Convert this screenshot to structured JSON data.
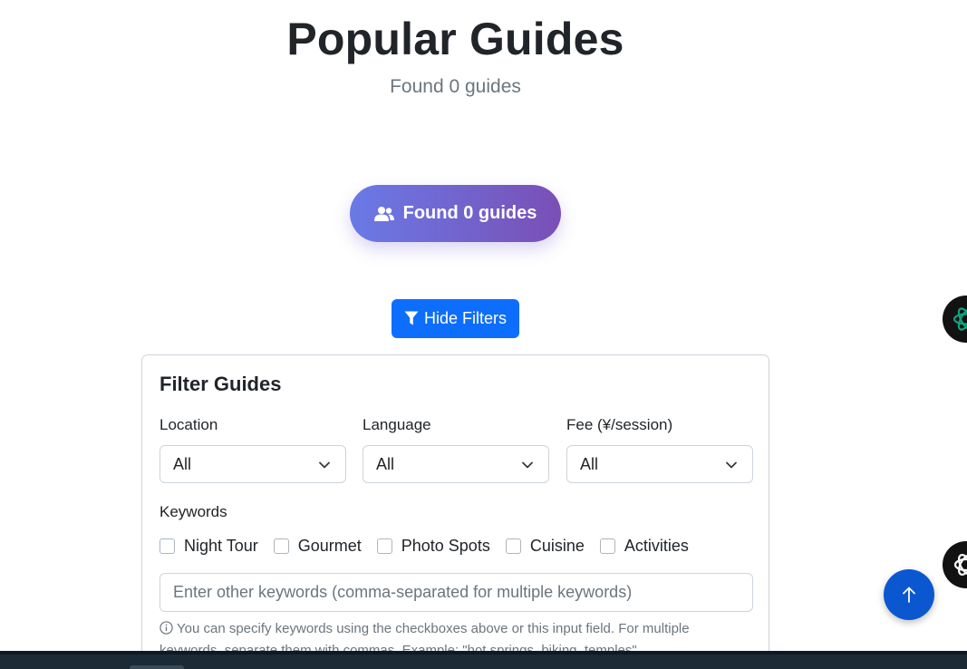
{
  "header": {
    "title": "Popular Guides",
    "subtitle": "Found 0 guides"
  },
  "summary": {
    "count_label": "Found 0 guides",
    "icon": "users-icon"
  },
  "toggle": {
    "label": "Hide Filters",
    "icon": "filter-icon"
  },
  "filters": {
    "title": "Filter Guides",
    "location": {
      "label": "Location",
      "value": "All"
    },
    "language": {
      "label": "Language",
      "value": "All"
    },
    "fee": {
      "label": "Fee (¥/session)",
      "value": "All"
    },
    "keywords_label": "Keywords",
    "keywords": [
      {
        "label": "Night Tour",
        "checked": false
      },
      {
        "label": "Gourmet",
        "checked": false
      },
      {
        "label": "Photo Spots",
        "checked": false
      },
      {
        "label": "Cuisine",
        "checked": false
      },
      {
        "label": "Activities",
        "checked": false
      }
    ],
    "other_keywords_placeholder": "Enter other keywords (comma-separated for multiple keywords)",
    "help_text": "You can specify keywords using the checkboxes above or this input field. For multiple keywords, separate them with commas. Example: \"hot springs, biking, temples\""
  },
  "scroll_top_icon": "arrow-up-icon",
  "colors": {
    "primary": "#0d6efd",
    "pill_gradient_start": "#6a7ae6",
    "pill_gradient_end": "#7a4fb6",
    "fab": "#0b57d0",
    "ext_icon_green": "#10a37f"
  }
}
